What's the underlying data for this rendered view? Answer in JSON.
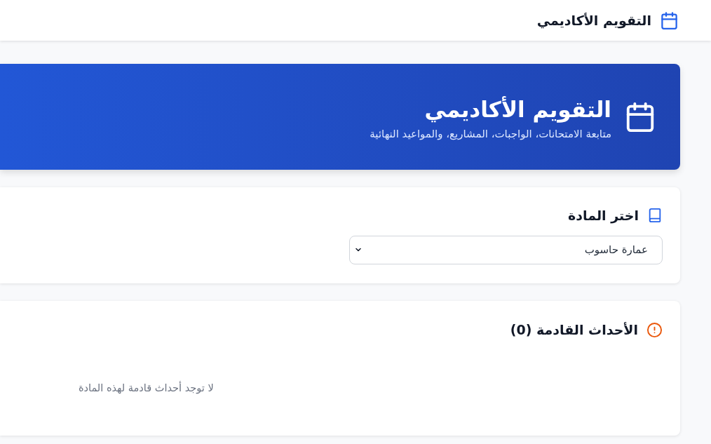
{
  "header": {
    "title": "التقويم الأكاديمي"
  },
  "hero": {
    "title": "التقويم الأكاديمي",
    "subtitle": "متابعة الامتحانات، الواجبات، المشاريع، والمواعيد النهائية"
  },
  "course_picker": {
    "heading": "اختر المادة",
    "value": "عمارة حاسوب"
  },
  "upcoming_events": {
    "heading": "الأحداث القادمة (0)",
    "empty_message": "لا توجد أحداث قادمة لهذه المادة"
  }
}
